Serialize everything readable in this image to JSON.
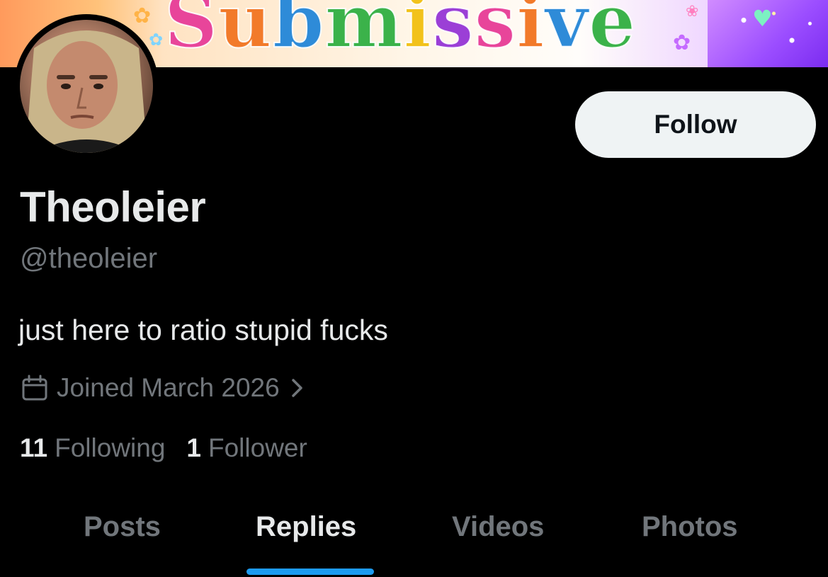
{
  "banner": {
    "word": "Submissive",
    "colors": [
      "#e8459a",
      "#f27a2a",
      "#2e8bd8",
      "#3bb24a",
      "#f2c21b",
      "#9b3fd6"
    ]
  },
  "profile": {
    "avatar_icon": "user-avatar",
    "display_name": "Theoleier",
    "handle": "@theoleier",
    "bio": "just here to ratio stupid fucks",
    "joined": "Joined March 2026",
    "follow_label": "Follow"
  },
  "stats": {
    "following_count": "11",
    "following_label": "Following",
    "followers_count": "1",
    "followers_label": "Follower"
  },
  "tabs": [
    {
      "label": "Posts",
      "active": false
    },
    {
      "label": "Replies",
      "active": true
    },
    {
      "label": "Videos",
      "active": false
    },
    {
      "label": "Photos",
      "active": false
    }
  ],
  "theme": {
    "background": "#000000",
    "text_primary": "#e7e9ea",
    "text_secondary": "#71767b",
    "accent": "#1d9bf0",
    "button_bg": "#eff3f4"
  }
}
